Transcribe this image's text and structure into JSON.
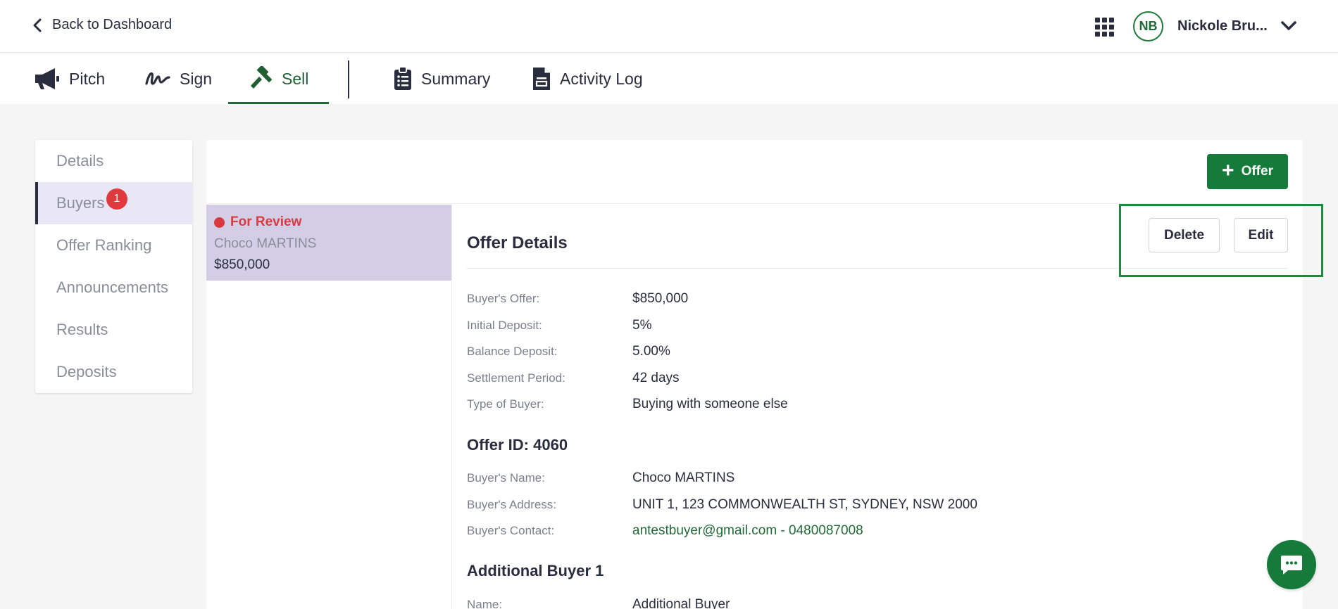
{
  "header": {
    "back_label": "Back to Dashboard",
    "avatar_initials": "NB",
    "user_name": "Nickole Bru..."
  },
  "tabs": [
    {
      "label": "Pitch",
      "icon": "megaphone-icon"
    },
    {
      "label": "Sign",
      "icon": "signature-icon"
    },
    {
      "label": "Sell",
      "icon": "gavel-icon",
      "active": true
    },
    {
      "label": "Summary",
      "icon": "clipboard-icon"
    },
    {
      "label": "Activity Log",
      "icon": "document-icon"
    }
  ],
  "sidebar": {
    "items": [
      {
        "label": "Details"
      },
      {
        "label": "Buyers",
        "badge": "1",
        "active": true
      },
      {
        "label": "Offer Ranking"
      },
      {
        "label": "Announcements"
      },
      {
        "label": "Results"
      },
      {
        "label": "Deposits"
      }
    ]
  },
  "actions": {
    "add_offer_label": "Offer",
    "delete_label": "Delete",
    "edit_label": "Edit"
  },
  "buyer_card": {
    "status": "For Review",
    "name": "Choco MARTINS",
    "price": "$850,000"
  },
  "offer_details": {
    "title": "Offer Details",
    "rows": [
      {
        "label": "Buyer's Offer:",
        "value": "$850,000"
      },
      {
        "label": "Initial Deposit:",
        "value": "5%"
      },
      {
        "label": "Balance Deposit:",
        "value": "5.00%"
      },
      {
        "label": "Settlement Period:",
        "value": "42 days"
      },
      {
        "label": "Type of Buyer:",
        "value": "Buying with someone else"
      }
    ]
  },
  "offer_id": {
    "title": "Offer ID: 4060",
    "rows": [
      {
        "label": "Buyer's Name:",
        "value": "Choco MARTINS"
      },
      {
        "label": "Buyer's Address:",
        "value": "UNIT 1, 123 COMMONWEALTH ST, SYDNEY, NSW 2000"
      },
      {
        "label": "Buyer's Contact:",
        "value": "antestbuyer@gmail.com - 0480087008"
      }
    ]
  },
  "additional_buyer": {
    "title": "Additional Buyer 1",
    "rows": [
      {
        "label": "Name:",
        "value": "Additional Buyer"
      }
    ]
  },
  "colors": {
    "primary_green": "#157a3a",
    "status_red": "#d93a3f",
    "selected_bg": "#d3cde6",
    "highlight_box": "#1e8a3c"
  }
}
